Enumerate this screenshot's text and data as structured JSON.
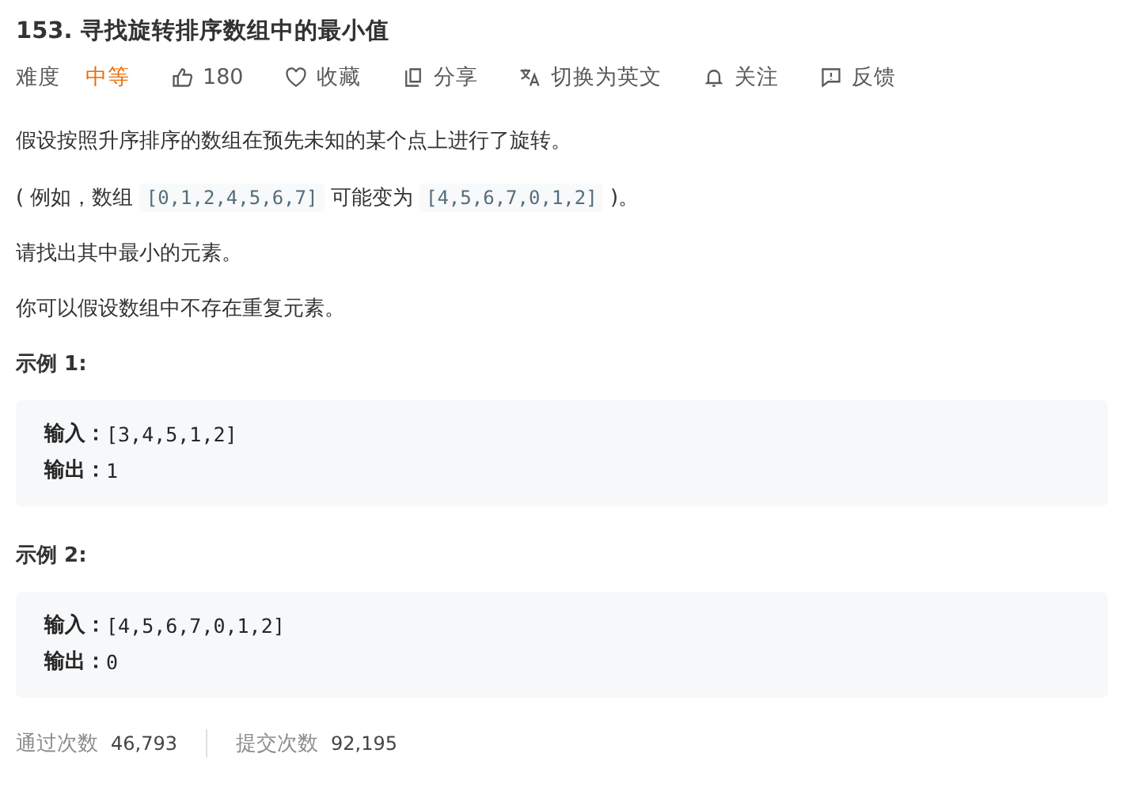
{
  "title": "153. 寻找旋转排序数组中的最小值",
  "toolbar": {
    "difficulty_label": "难度",
    "difficulty": "中等",
    "actions": [
      {
        "kind": "like",
        "label": "180"
      },
      {
        "kind": "favorite",
        "label": "收藏"
      },
      {
        "kind": "share",
        "label": "分享"
      },
      {
        "kind": "translate",
        "label": "切换为英文"
      },
      {
        "kind": "follow",
        "label": "关注"
      },
      {
        "kind": "feedback",
        "label": "反馈"
      }
    ]
  },
  "description": [
    [
      {
        "kind": "text",
        "text": "假设按照升序排序的数组在预先未知的某个点上进行了旋转。"
      }
    ],
    [
      {
        "kind": "text",
        "text": "( 例如，数组 "
      },
      {
        "kind": "code",
        "text": "[0,1,2,4,5,6,7]"
      },
      {
        "kind": "text",
        "text": " 可能变为 "
      },
      {
        "kind": "code",
        "text": "[4,5,6,7,0,1,2]"
      },
      {
        "kind": "text",
        "text": " )。"
      }
    ],
    [
      {
        "kind": "text",
        "text": "请找出其中最小的元素。"
      }
    ],
    [
      {
        "kind": "text",
        "text": "你可以假设数组中不存在重复元素。"
      }
    ]
  ],
  "examples": [
    {
      "heading": "示例 1:",
      "lines": [
        {
          "label": "输入：",
          "value": "[3,4,5,1,2]"
        },
        {
          "label": "输出：",
          "value": "1"
        }
      ]
    },
    {
      "heading": "示例 2:",
      "lines": [
        {
          "label": "输入：",
          "value": "[4,5,6,7,0,1,2]"
        },
        {
          "label": "输出：",
          "value": "0"
        }
      ]
    }
  ],
  "stats": [
    {
      "label": "通过次数",
      "value": "46,793"
    },
    {
      "label": "提交次数",
      "value": "92,195"
    }
  ]
}
